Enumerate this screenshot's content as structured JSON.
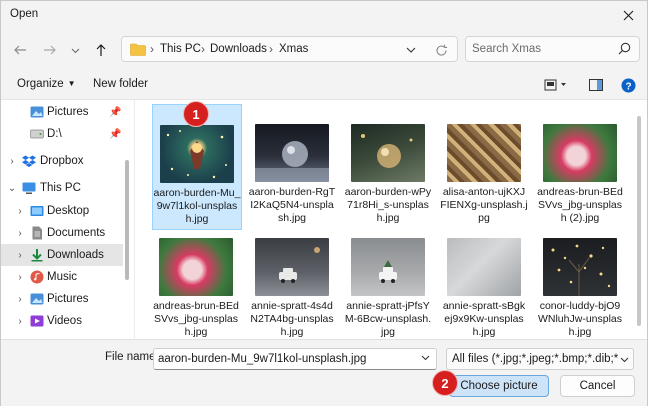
{
  "window": {
    "title": "Open"
  },
  "address": {
    "crumbs": [
      "This PC",
      "Downloads",
      "Xmas"
    ],
    "search_placeholder": "Search Xmas"
  },
  "toolbar": {
    "organize": "Organize",
    "new_folder": "New folder"
  },
  "nav": {
    "items": [
      {
        "label": "Pictures",
        "icon": "pictures-icon",
        "pinned": true
      },
      {
        "label": "D:\\",
        "icon": "drive-icon",
        "pinned": true
      },
      {
        "label": "Dropbox",
        "icon": "dropbox-icon"
      },
      {
        "label": "This PC",
        "icon": "this-pc-icon",
        "expanded": true
      },
      {
        "label": "Desktop",
        "icon": "desktop-icon"
      },
      {
        "label": "Documents",
        "icon": "documents-icon"
      },
      {
        "label": "Downloads",
        "icon": "downloads-icon",
        "selected": true
      },
      {
        "label": "Music",
        "icon": "music-icon"
      },
      {
        "label": "Pictures",
        "icon": "pictures-icon"
      },
      {
        "label": "Videos",
        "icon": "videos-icon"
      }
    ]
  },
  "files": [
    {
      "name": "aaron-burden-Mu_9w7l1kol-unsplash.jpg",
      "selected": true
    },
    {
      "name": "aaron-burden-RgTI2KaQ5N4-unsplash.jpg"
    },
    {
      "name": "aaron-burden-wPy71r8Hi_s-unsplash.jpg"
    },
    {
      "name": "alisa-anton-ujKXJFIENXg-unsplash.jpg"
    },
    {
      "name": "andreas-brun-BEdSVvs_jbg-unsplash (2).jpg"
    },
    {
      "name": "andreas-brun-BEdSVvs_jbg-unsplash.jpg"
    },
    {
      "name": "annie-spratt-4s4dN2TA4bg-unsplash.jpg"
    },
    {
      "name": "annie-spratt-jPfsYM-6Bcw-unsplash.jpg"
    },
    {
      "name": "annie-spratt-sBgkej9x9Kw-unsplash.jpg"
    },
    {
      "name": "conor-luddy-bjO9WNluhJw-unsplash.jpg"
    }
  ],
  "footer": {
    "file_name_label": "File name:",
    "file_name_value": "aaron-burden-Mu_9w7l1kol-unsplash.jpg",
    "file_type": "All files (*.jpg;*.jpeg;*.bmp;*.dib;*.png",
    "open_button": "Choose picture",
    "cancel_button": "Cancel"
  },
  "badges": [
    "1",
    "2"
  ],
  "colors": {
    "accent": "#0067c0",
    "selection": "#cce8ff",
    "badge": "#d62020"
  }
}
